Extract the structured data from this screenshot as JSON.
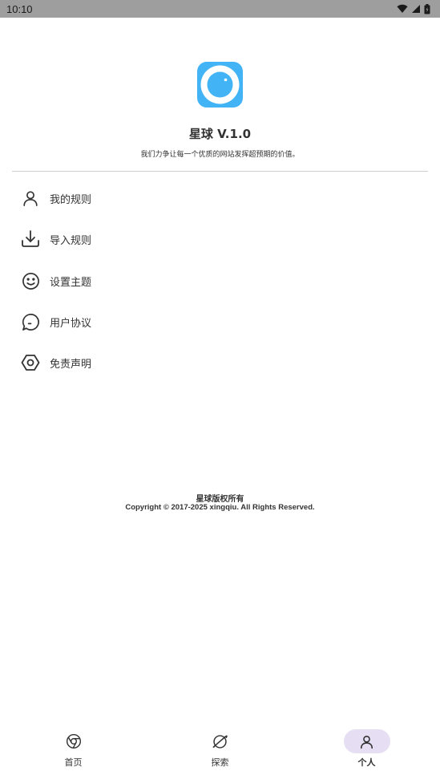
{
  "status_bar": {
    "time": "10:10",
    "icons": [
      "wifi-icon",
      "signal-icon",
      "battery-icon"
    ]
  },
  "app": {
    "title": "星球 V.1.0",
    "slogan": "我们力争让每一个优质的网站发挥超预期的价值。",
    "logo_color": "#42b4f5"
  },
  "menu": {
    "items": [
      {
        "label": "我的规则",
        "icon": "user-icon"
      },
      {
        "label": "导入规则",
        "icon": "download-icon"
      },
      {
        "label": "设置主题",
        "icon": "smile-icon"
      },
      {
        "label": "用户协议",
        "icon": "chat-bubble-icon"
      },
      {
        "label": "免责声明",
        "icon": "hexagon-icon"
      }
    ]
  },
  "footer": {
    "copyright_title": "星球版权所有",
    "copyright_text": "Copyright © 2017-2025 xingqiu. All Rights Reserved."
  },
  "bottom_nav": {
    "tabs": [
      {
        "label": "首页",
        "icon": "browser-icon",
        "active": false
      },
      {
        "label": "探索",
        "icon": "planet-icon",
        "active": false
      },
      {
        "label": "个人",
        "icon": "user-icon",
        "active": true
      }
    ],
    "active_color": "#e6dff3"
  }
}
